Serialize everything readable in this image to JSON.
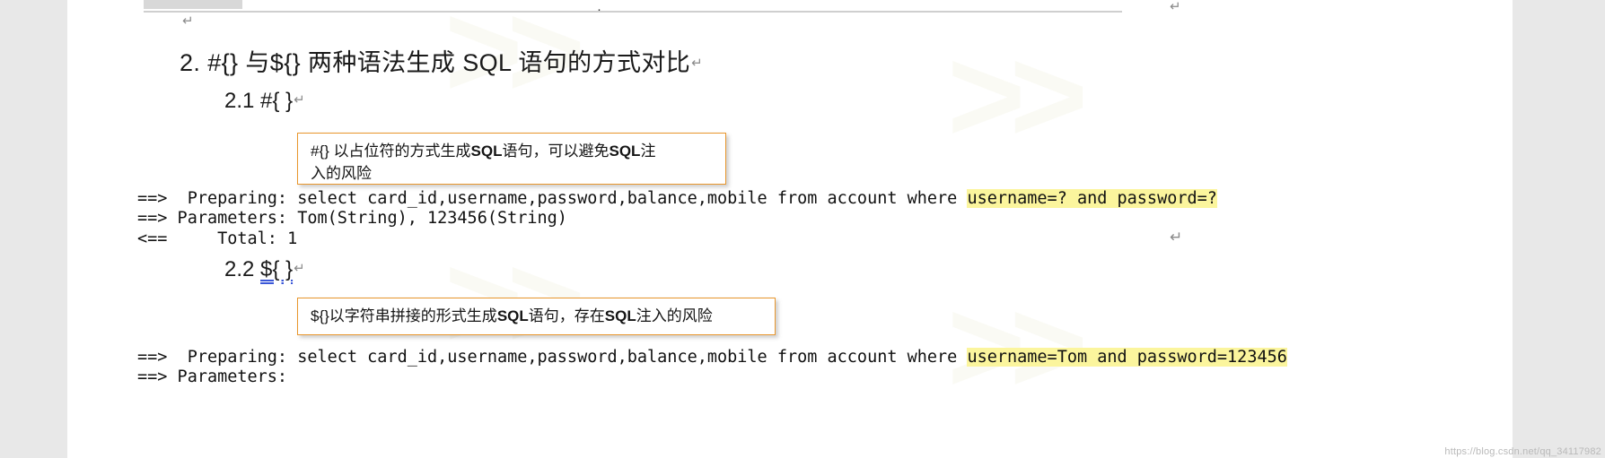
{
  "document": {
    "headings": {
      "section_2": "2. #{} 与${} 两种语法生成 SQL 语句的方式对比",
      "section_2_1": "2.1 #{ }",
      "section_2_2_number": "2.2 ",
      "section_2_2_code": "${ }"
    },
    "pilcrow": "↵",
    "callouts": [
      {
        "id": "callout-hash-brace",
        "line1_part1": "#{} 以占位符的方式生成",
        "line1_bold": "SQL",
        "line1_part2": "语句，可以避免",
        "line1_bold2": "SQL",
        "line1_part3": "注",
        "line2": "入的风险",
        "border_color": "#e8962c"
      },
      {
        "id": "callout-dollar-brace",
        "part1": "${}以字符串拼接的形式生成",
        "bold1": "SQL",
        "part2": "语句，存在",
        "bold2": "SQL",
        "part3": "注入的风险",
        "border_color": "#e8962c"
      }
    ],
    "console": {
      "highlight_color": "#fbf59d",
      "lines": [
        {
          "id": "log-line-1",
          "prefix": "==>  Preparing: select card_id,username,password,balance,mobile from account where ",
          "highlight": "username=? and password=?"
        },
        {
          "id": "log-line-2",
          "prefix": "==> Parameters: Tom(String), 123456(String)",
          "highlight": ""
        },
        {
          "id": "log-line-3",
          "prefix": "<==     Total: 1",
          "highlight": ""
        },
        {
          "id": "log-line-4",
          "prefix": "==>  Preparing: select card_id,username,password,balance,mobile from account where ",
          "highlight": "username=Tom and password=123456"
        },
        {
          "id": "log-line-5",
          "prefix": "==> Parameters: ",
          "highlight": ""
        }
      ]
    },
    "credit": "https://blog.csdn.net/qq_34117982"
  }
}
